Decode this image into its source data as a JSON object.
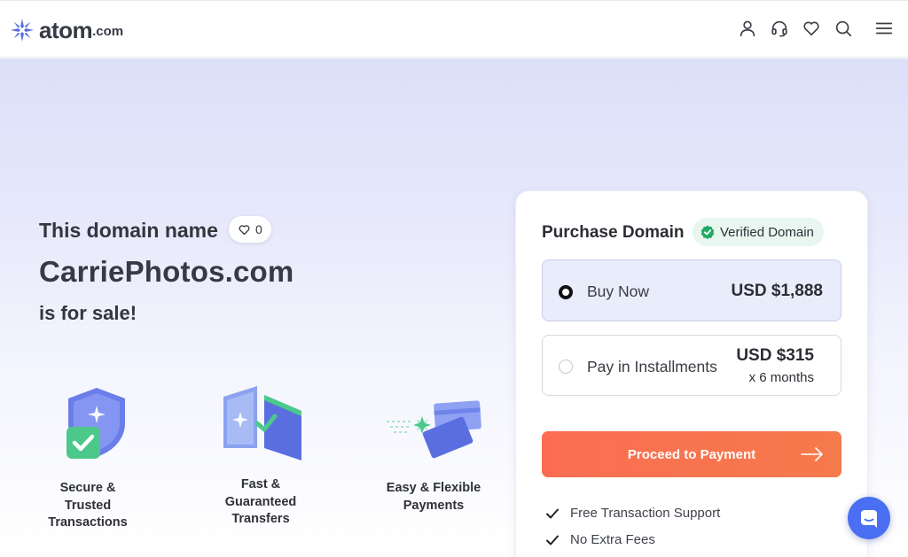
{
  "header": {
    "logo_text": "atom",
    "logo_tld": ".com",
    "icons": [
      "user-icon",
      "headset-icon",
      "heart-icon",
      "search-icon",
      "menu-icon"
    ]
  },
  "hero": {
    "intro_line1": "This domain name",
    "likes_count": "0",
    "domain": "CarriePhotos.com",
    "intro_line2": "is for sale!"
  },
  "features": [
    {
      "label": "Secure & Trusted Transactions",
      "icon": "shield-check-icon"
    },
    {
      "label": "Fast & Guaranteed Transfers",
      "icon": "transfer-icon"
    },
    {
      "label": "Easy & Flexible Payments",
      "icon": "cards-icon"
    }
  ],
  "purchase": {
    "title": "Purchase Domain",
    "verified_label": "Verified Domain",
    "options": [
      {
        "label": "Buy Now",
        "price": "USD $1,888",
        "selected": true
      },
      {
        "label": "Pay in Installments",
        "price": "USD $315",
        "sub": "x 6 months",
        "selected": false
      }
    ],
    "cta": "Proceed to Payment",
    "bullets": [
      "Free Transaction Support",
      "No Extra Fees"
    ]
  },
  "colors": {
    "accent": "#4a6ff2",
    "cta": "#fb6d52",
    "verified_bg": "#e8f6ef",
    "verified_icon": "#22a965"
  }
}
